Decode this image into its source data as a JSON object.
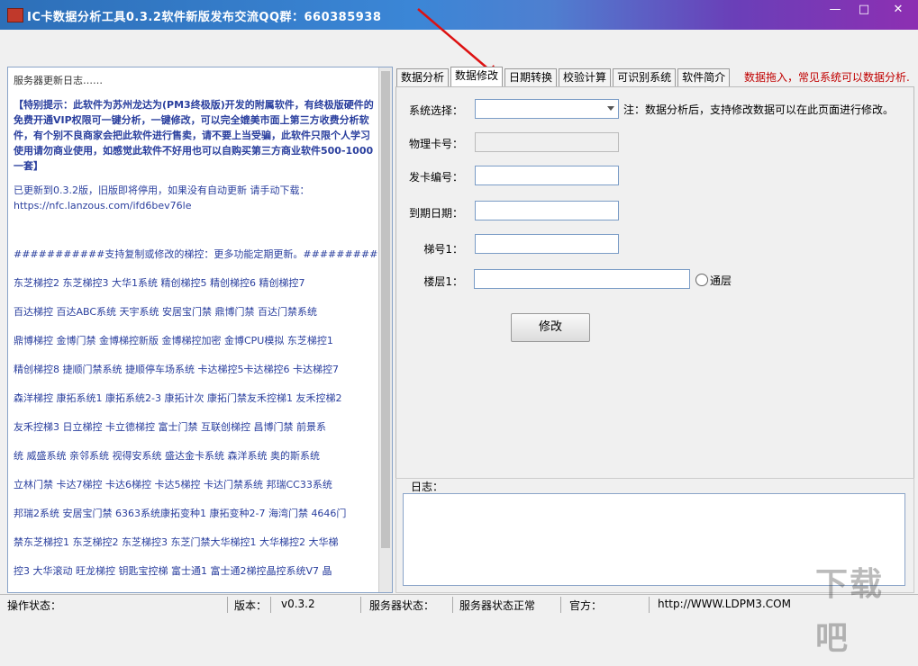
{
  "window": {
    "title": "IC卡数据分析工具0.3.2软件新版发布交流QQ群：660385938",
    "minimize": "—",
    "maximize": "□",
    "close": "✕"
  },
  "log_panel": {
    "title": "服务器更新日志……",
    "notice": "【特别提示：此软件为苏州龙达为(PM3终极版)开发的附属软件，有终极版硬件的免费开通VIP权限可一键分析，一键修改，可以完全媲美市面上第三方收费分析软件，有个别不良商家会把此软件进行售卖，请不要上当受骗，此软件只限个人学习使用请勿商业使用，如感觉此软件不好用也可以自购买第三方商业软件500-1000一套】",
    "update": "已更新到0.3.2版，旧版即将停用，如果没有自动更新 请手动下载：",
    "url": "https://nfc.lanzous.com/ifd6bev76le",
    "support": "###########支持复制或修改的梯控：更多功能定期更新。###############",
    "brands": [
      "东芝梯控2 东芝梯控3 大华1系统 精创梯控5 精创梯控6 精创梯控7",
      "百达梯控 百达ABC系统 天宇系统 安居宝门禁 鼎博门禁 百达门禁系统",
      "鼎博梯控 金博门禁 金博梯控新版 金博梯控加密 金博CPU模拟 东芝梯控1",
      "精创梯控8 捷顺门禁系统 捷顺停车场系统 卡达梯控5卡达梯控6 卡达梯控7",
      "森洋梯控 康拓系统1 康拓系统2-3 康拓计次 康拓门禁友禾控梯1 友禾控梯2",
      "友禾控梯3 日立梯控 卡立德梯控  富士门禁 互联创梯控 昌博门禁 前景系",
      "统 威盛系统 亲邻系统 视得安系统  盛达金卡系统 森洋系统 奥的斯系统",
      "立林门禁 卡达7梯控 卡达6梯控 卡达5梯控 卡达门禁系统 邦瑞CC33系统",
      "邦瑞2系统 安居宝门禁 6363系统康拓变种1 康拓变种2-7 海湾门禁 4646门",
      "禁东芝梯控1 东芝梯控2 东芝梯控3 东芝门禁大华梯控1  大华梯控2 大华梯",
      "控3 大华滚动  旺龙梯控  钥匙宝控梯 富士通1 富士通2梯控晶控系统V7 晶"
    ]
  },
  "tabs": [
    {
      "label": "数据分析"
    },
    {
      "label": "数据修改"
    },
    {
      "label": "日期转换"
    },
    {
      "label": "校验计算"
    },
    {
      "label": "可识别系统"
    },
    {
      "label": "软件简介"
    }
  ],
  "tab_note": "数据拖入，常见系统可以数据分析.",
  "form": {
    "system_label": "系统选择：",
    "system_value": "",
    "note": "注：数据分析后，支持修改数据可以在此页面进行修改。",
    "physical_label": "物理卡号：",
    "card_no_label": "发卡编号：",
    "expiry_label": "到期日期：",
    "elevator_label": "梯号1：",
    "floor_label": "楼层1：",
    "all_floors_label": "通层",
    "modify_button": "修改"
  },
  "log_group": {
    "label": "日志："
  },
  "status": {
    "op_label": "操作状态：",
    "op_value": "",
    "version_label": "版本：",
    "version_value": "v0.3.2",
    "server_label": "服务器状态：",
    "server_value": "服务器状态正常",
    "official_label": "官方：",
    "official_value": "http://WWW.LDPM3.COM"
  },
  "colors": {
    "accent_red": "#c00000",
    "log_text_blue": "#2a3f9e",
    "title_gradient_start": "#2d6fb8",
    "title_gradient_end": "#8d2fb2"
  },
  "watermark": "下载吧"
}
